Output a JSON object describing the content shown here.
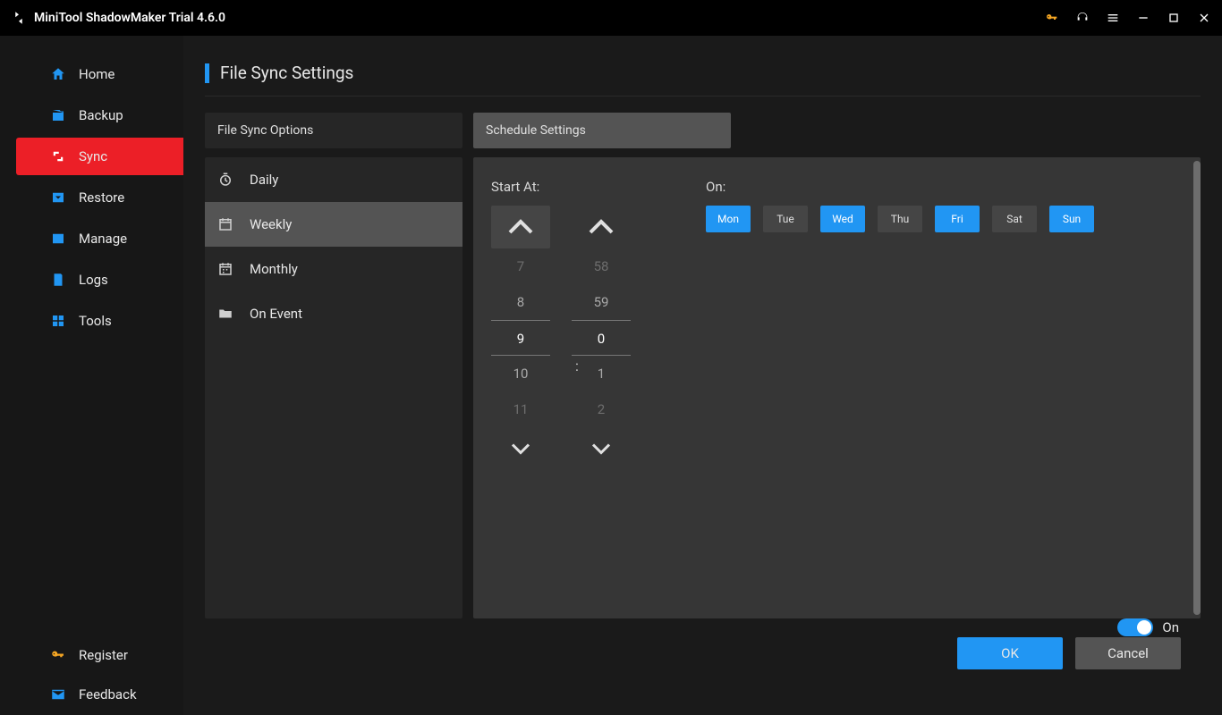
{
  "titlebar": {
    "title": "MiniTool ShadowMaker Trial 4.6.0"
  },
  "sidebar": {
    "items": [
      {
        "label": "Home"
      },
      {
        "label": "Backup"
      },
      {
        "label": "Sync"
      },
      {
        "label": "Restore"
      },
      {
        "label": "Manage"
      },
      {
        "label": "Logs"
      },
      {
        "label": "Tools"
      }
    ],
    "bottom": {
      "register": "Register",
      "feedback": "Feedback"
    }
  },
  "page": {
    "title": "File Sync Settings"
  },
  "tabs": {
    "options": "File Sync Options",
    "schedule": "Schedule Settings"
  },
  "schedule_types": {
    "daily": "Daily",
    "weekly": "Weekly",
    "monthly": "Monthly",
    "on_event": "On Event"
  },
  "schedule": {
    "start_at_label": "Start At:",
    "on_label": "On:",
    "hours": {
      "vals": [
        "7",
        "8",
        "9",
        "10",
        "11"
      ],
      "selected": "9"
    },
    "minutes": {
      "vals": [
        "58",
        "59",
        "0",
        "1",
        "2"
      ],
      "selected": "0"
    },
    "days": [
      {
        "short": "Mon",
        "on": true
      },
      {
        "short": "Tue",
        "on": false
      },
      {
        "short": "Wed",
        "on": true
      },
      {
        "short": "Thu",
        "on": false
      },
      {
        "short": "Fri",
        "on": true
      },
      {
        "short": "Sat",
        "on": false
      },
      {
        "short": "Sun",
        "on": true
      }
    ]
  },
  "footer": {
    "toggle_label": "On",
    "ok": "OK",
    "cancel": "Cancel"
  }
}
